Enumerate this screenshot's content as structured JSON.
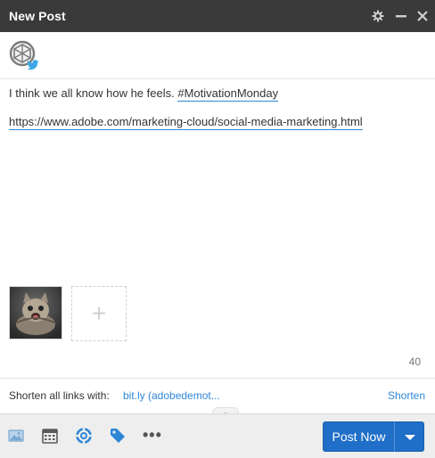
{
  "window": {
    "title": "New Post"
  },
  "account": {
    "network": "Twitter"
  },
  "message": {
    "text_line": "I think we all know how he feels.",
    "hashtag": "#MotivationMonday",
    "url": "https://www.adobe.com/marketing-cloud/social-media-marketing.html"
  },
  "media": {
    "add_symbol": "+"
  },
  "char_count": "40",
  "shorten": {
    "label": "Shorten all links with:",
    "value": "bit.ly (adobedemot...",
    "button": "Shorten"
  },
  "toolbar": {
    "more_label": "•••",
    "post_label": "Post Now"
  },
  "colors": {
    "titlebar": "#3a3a3a",
    "accent": "#2f86d6",
    "post_button": "#1f6ec8"
  }
}
